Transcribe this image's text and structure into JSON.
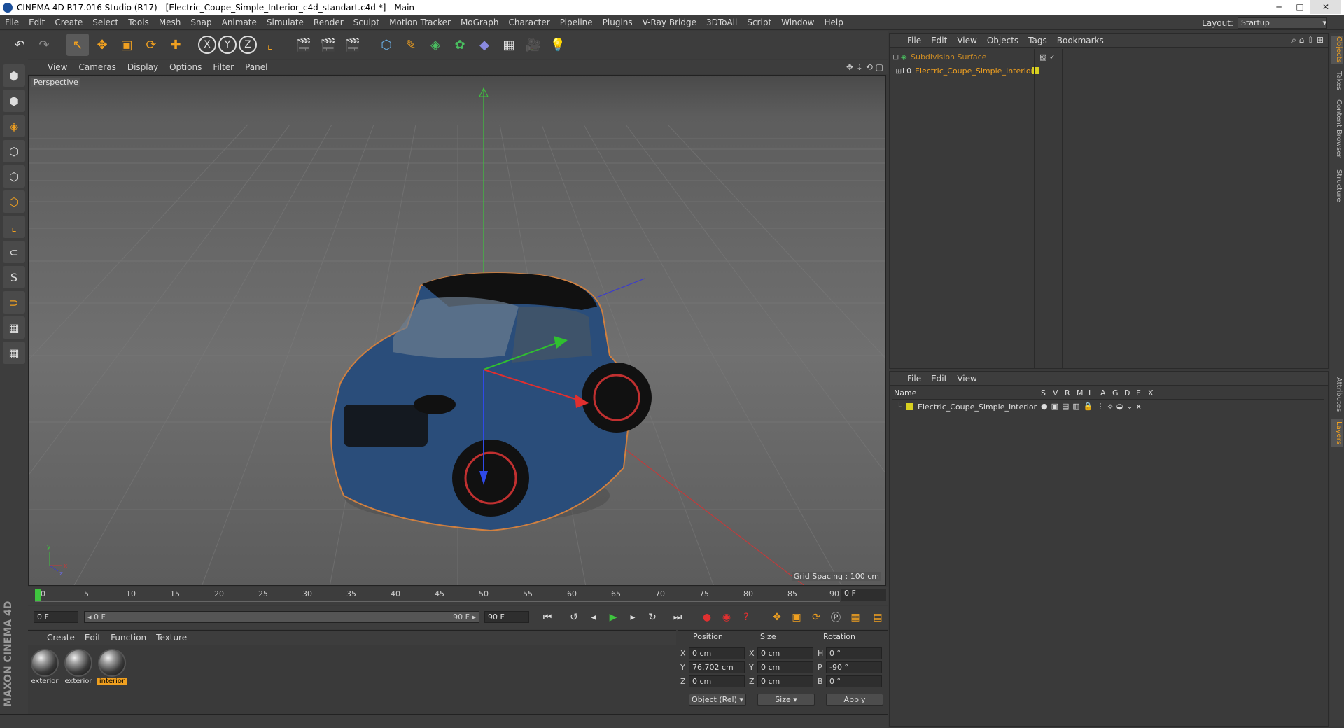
{
  "window": {
    "title": "CINEMA 4D R17.016 Studio (R17) - [Electric_Coupe_Simple_Interior_c4d_standart.c4d *] - Main",
    "minimize": "─",
    "maximize": "□",
    "close": "✕"
  },
  "menubar": {
    "items": [
      "File",
      "Edit",
      "Create",
      "Select",
      "Tools",
      "Mesh",
      "Snap",
      "Animate",
      "Simulate",
      "Render",
      "Sculpt",
      "Motion Tracker",
      "MoGraph",
      "Character",
      "Pipeline",
      "Plugins",
      "V-Ray Bridge",
      "3DToAll",
      "Script",
      "Window",
      "Help"
    ],
    "layout_label": "Layout:",
    "layout_value": "Startup"
  },
  "toolbar": {
    "undo": "↶",
    "redo": "↷",
    "select": "↖",
    "move": "✥",
    "scale": "▣",
    "rotate": "⟳",
    "add": "✚",
    "x": "X",
    "y": "Y",
    "z": "Z",
    "coord": "⌞",
    "render_view": "🎬",
    "render": "🎬",
    "render_settings": "🎬",
    "cube": "⬡",
    "pen": "✎",
    "subdiv": "◈",
    "array": "✿",
    "deformer": "◆",
    "floor": "▦",
    "camera": "🎥",
    "light": "💡"
  },
  "lefttools": [
    "⬢",
    "⬢",
    "◈",
    "⬡",
    "⬡",
    "⬡",
    "⌞",
    "⊂",
    "S",
    "⊃",
    "▦",
    "▦"
  ],
  "viewport": {
    "menu": [
      "View",
      "Cameras",
      "Display",
      "Options",
      "Filter",
      "Panel"
    ],
    "label": "Perspective",
    "grid_spacing": "Grid Spacing : 100 cm"
  },
  "timeline": {
    "ticks": [
      "0",
      "5",
      "10",
      "15",
      "20",
      "25",
      "30",
      "35",
      "40",
      "45",
      "50",
      "55",
      "60",
      "65",
      "70",
      "75",
      "80",
      "85",
      "90"
    ],
    "current_frame": "0 F"
  },
  "transport": {
    "start": "0 F",
    "range_start": "◂ 0 F",
    "range_end": "90 F ▸",
    "end": "90 F"
  },
  "materials": {
    "menu": [
      "Create",
      "Edit",
      "Function",
      "Texture"
    ],
    "items": [
      "exterior",
      "exterior",
      "interior"
    ],
    "selected_index": 2
  },
  "attributes": {
    "headers": {
      "position": "Position",
      "size": "Size",
      "rotation": "Rotation"
    },
    "rows": [
      {
        "axis": "X",
        "pos": "0 cm",
        "size_axis": "X",
        "size": "0 cm",
        "rot_axis": "H",
        "rot": "0 °"
      },
      {
        "axis": "Y",
        "pos": "76.702 cm",
        "size_axis": "Y",
        "size": "0 cm",
        "rot_axis": "P",
        "rot": "-90 °"
      },
      {
        "axis": "Z",
        "pos": "0 cm",
        "size_axis": "Z",
        "size": "0 cm",
        "rot_axis": "B",
        "rot": "0 °"
      }
    ],
    "mode": "Object (Rel)",
    "size_mode": "Size",
    "apply": "Apply"
  },
  "object_manager": {
    "menu": [
      "File",
      "Edit",
      "View",
      "Objects",
      "Tags",
      "Bookmarks"
    ],
    "objects": [
      {
        "name": "Subdivision Surface",
        "level": 0
      },
      {
        "name": "Electric_Coupe_Simple_Interior",
        "level": 1
      }
    ]
  },
  "layer_manager": {
    "menu": [
      "File",
      "Edit",
      "View"
    ],
    "col_name": "Name",
    "cols": [
      "S",
      "V",
      "R",
      "M",
      "L",
      "A",
      "G",
      "D",
      "E",
      "X"
    ],
    "layers": [
      {
        "name": "Electric_Coupe_Simple_Interior"
      }
    ]
  },
  "right_tabs": [
    "Objects",
    "Takes",
    "Content Browser",
    "Structure",
    "Attributes",
    "Layers"
  ],
  "branding": {
    "logo": "MAXON CINEMA 4D"
  },
  "colors": {
    "accent": "#f0a020",
    "car_body": "#2a4d7a",
    "background": "#3a3a3a"
  }
}
